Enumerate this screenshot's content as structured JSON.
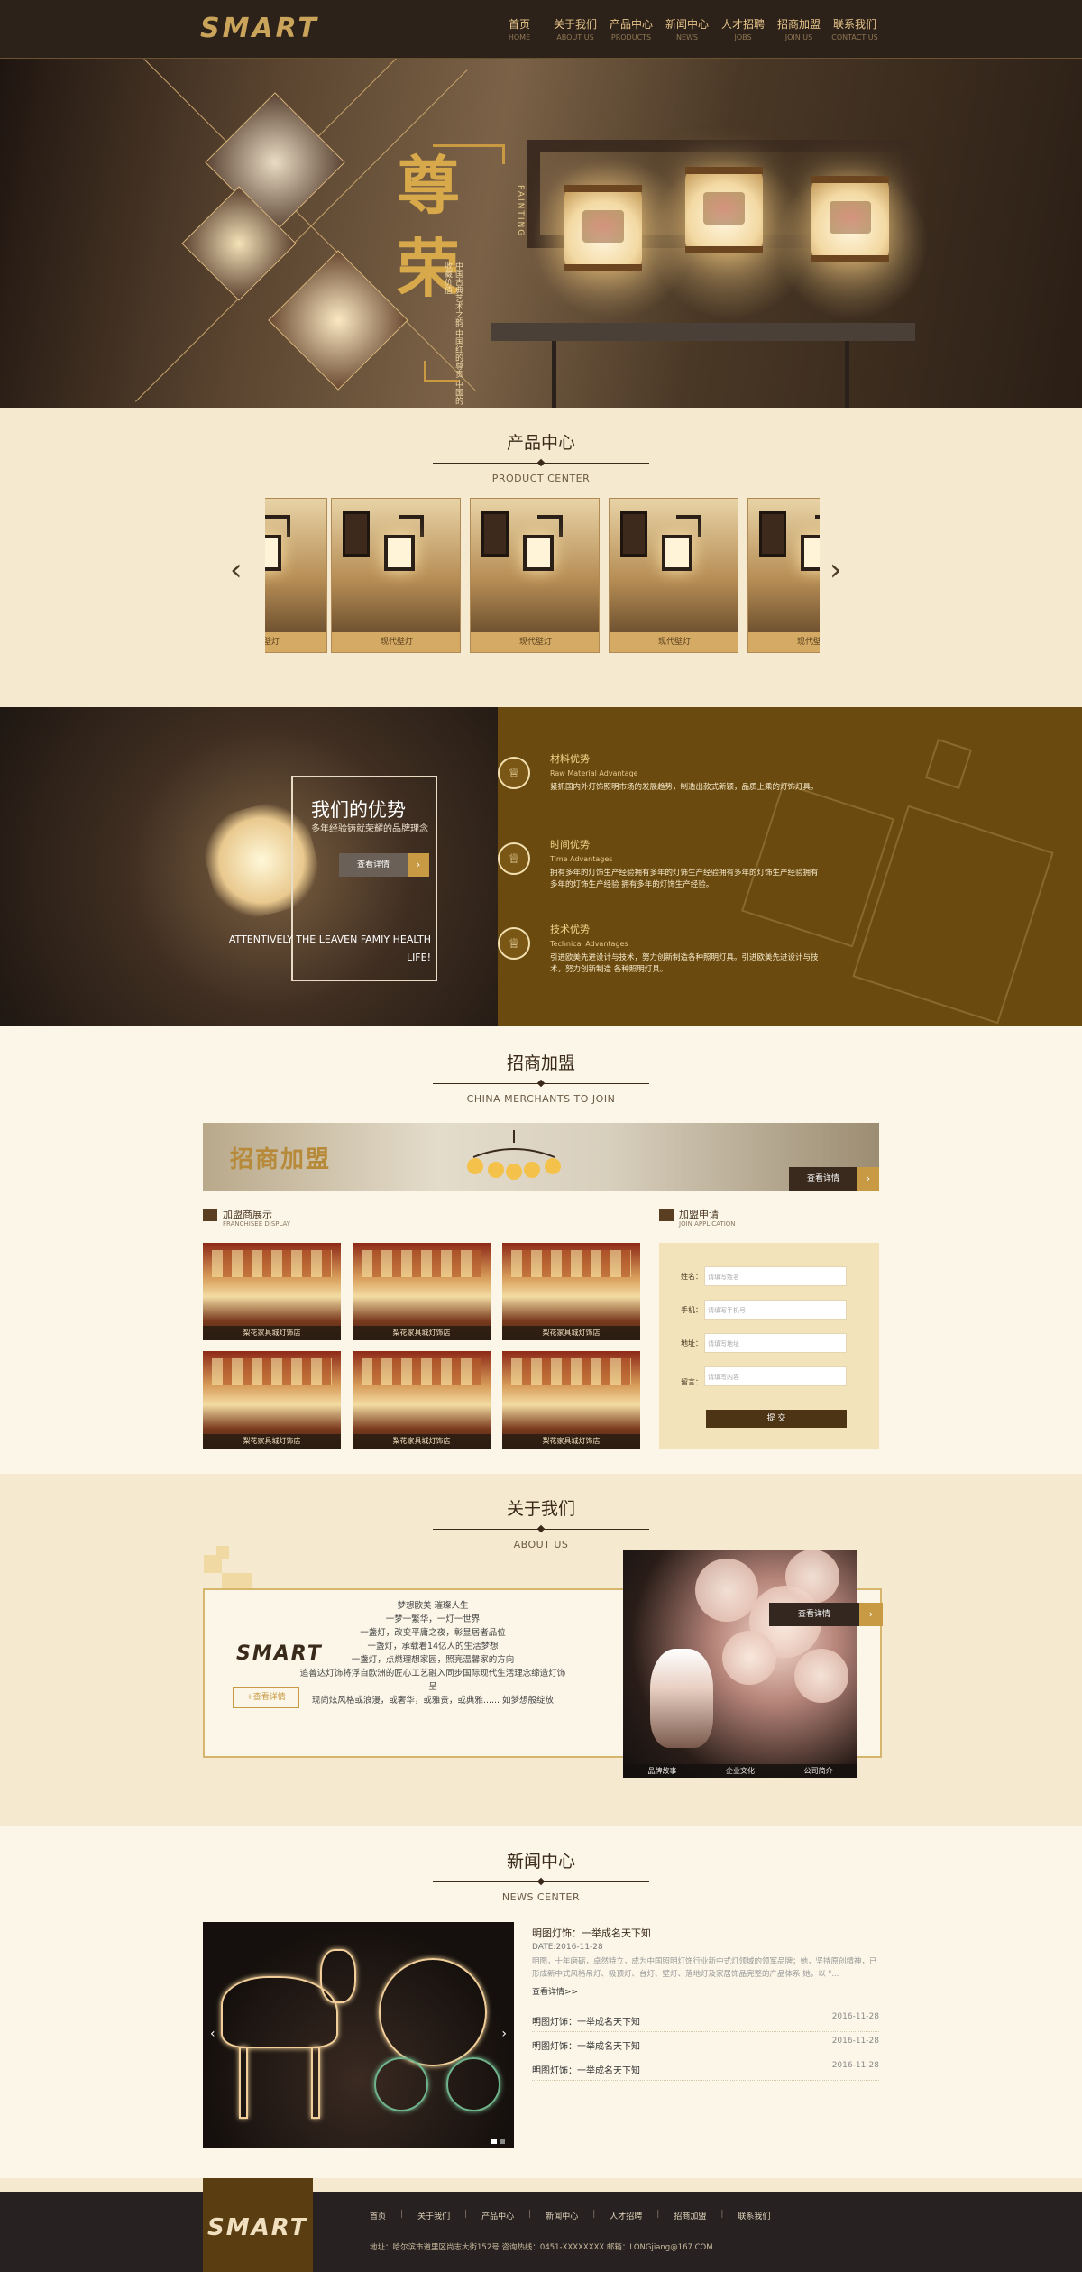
{
  "header": {
    "logo": "SMART",
    "nav": [
      {
        "cn": "首页",
        "en": "HOME"
      },
      {
        "cn": "关于我们",
        "en": "ABOUT US"
      },
      {
        "cn": "产品中心",
        "en": "PRODUCTS"
      },
      {
        "cn": "新闻中心",
        "en": "NEWS"
      },
      {
        "cn": "人才招聘",
        "en": "JOBS"
      },
      {
        "cn": "招商加盟",
        "en": "JOIN US"
      },
      {
        "cn": "联系我们",
        "en": "CONTACT US"
      }
    ]
  },
  "hero": {
    "title": "尊荣",
    "en_vertical": "PAINTING",
    "subtitle": "中国古典艺术之韵 中国红的尊贵 中国的收藏价值"
  },
  "products": {
    "title_cn": "产品中心",
    "title_en": "PRODUCT CENTER",
    "items": [
      "现代壁灯",
      "现代壁灯",
      "现代壁灯",
      "现代壁灯",
      "现代壁灯"
    ],
    "prev_icon": "chevron-left-icon",
    "next_icon": "chevron-right-icon"
  },
  "advantage": {
    "title": "我们的优势",
    "subtitle": "多年经验铸就荣耀的品牌理念",
    "button": "查看详情",
    "quote": "ATTENTIVELY THE LEAVEN FAMIY HEALTH LIFE!",
    "items": [
      {
        "cn": "材料优势",
        "en": "Raw Material Advantage",
        "desc": "紧抓国内外灯饰照明市场的发展趋势，制造出款式新颖，品质上乘的灯饰灯具。",
        "icon": "crown-icon"
      },
      {
        "cn": "时间优势",
        "en": "Time Advantages",
        "desc": "拥有多年的灯饰生产经验拥有多年的灯饰生产经验拥有多年的灯饰生产经验拥有多年的灯饰生产经验 拥有多年的灯饰生产经验。",
        "icon": "crown-icon"
      },
      {
        "cn": "技术优势",
        "en": "Technical Advantages",
        "desc": "引进欧美先进设计与技术，努力创新制造各种照明灯具。引进欧美先进设计与技术，努力创新制造 各种照明灯具。",
        "icon": "crown-icon"
      }
    ]
  },
  "join": {
    "title_cn": "招商加盟",
    "title_en": "CHINA MERCHANTS TO JOIN",
    "banner_text": "招商加盟",
    "banner_button": "查看详情",
    "showcase_cn": "加盟商展示",
    "showcase_en": "FRANCHISEE DISPLAY",
    "franchisees": [
      "梨花家具城灯饰店",
      "梨花家具城灯饰店",
      "梨花家具城灯饰店",
      "梨花家具城灯饰店",
      "梨花家具城灯饰店",
      "梨花家具城灯饰店"
    ],
    "apply_cn": "加盟申请",
    "apply_en": "JOIN APPLICATION",
    "form": {
      "name_label": "姓名：",
      "name_ph": "请填写姓名",
      "phone_label": "手机：",
      "phone_ph": "请填写手机号",
      "addr_label": "地址：",
      "addr_ph": "请填写地址",
      "msg_label": "留言：",
      "msg_ph": "请填写内容",
      "submit": "提 交"
    }
  },
  "about": {
    "title_cn": "关于我们",
    "title_en": "ABOUT US",
    "logo": "SMART",
    "more": "+查看详情",
    "lines": [
      "梦想欧美 璀璨人生",
      "一梦一繁华，一灯一世界",
      "一盏灯，改变平庸之夜，彰显居者品位",
      "一盏灯，承载着14亿人的生活梦想",
      "一盏灯，点燃理想家园，照亮温馨家的方向",
      "追善达灯饰将浮自欧洲的匠心工艺融入同步国际现代生活理念缔造灯饰呈",
      "现尚炫风格或浪漫，或奢华，或雅贵，或典雅...... 如梦想般绽放"
    ],
    "button": "查看详情",
    "tabs": [
      "品牌故事",
      "企业文化",
      "公司简介"
    ]
  },
  "news": {
    "title_cn": "新闻中心",
    "title_en": "NEWS CENTER",
    "featured": {
      "title": "明图灯饰：一举成名天下知",
      "date": "DATE:2016-11-28",
      "summary": "明图，十年磨砺，卓然特立，成为中国照明灯饰行业新中式灯领域的领军品牌；她，坚持原创精神，已形成新中式风格吊灯、吸顶灯、台灯、壁灯、落地灯及家居饰品完整的产品体系 她，以 \"...",
      "more": "查看详情>>"
    },
    "list": [
      {
        "title": "明图灯饰：一举成名天下知",
        "date": "2016-11-28"
      },
      {
        "title": "明图灯饰：一举成名天下知",
        "date": "2016-11-28"
      },
      {
        "title": "明图灯饰：一举成名天下知",
        "date": "2016-11-28"
      }
    ]
  },
  "footer": {
    "logo": "SMART",
    "nav": [
      "首页",
      "关于我们",
      "产品中心",
      "新闻中心",
      "人才招聘",
      "招商加盟",
      "联系我们"
    ],
    "address": "地址：哈尔滨市道里区尚志大街152号 咨询热线：0451-XXXXXXXX 邮箱：LONGjiang@167.COM"
  }
}
